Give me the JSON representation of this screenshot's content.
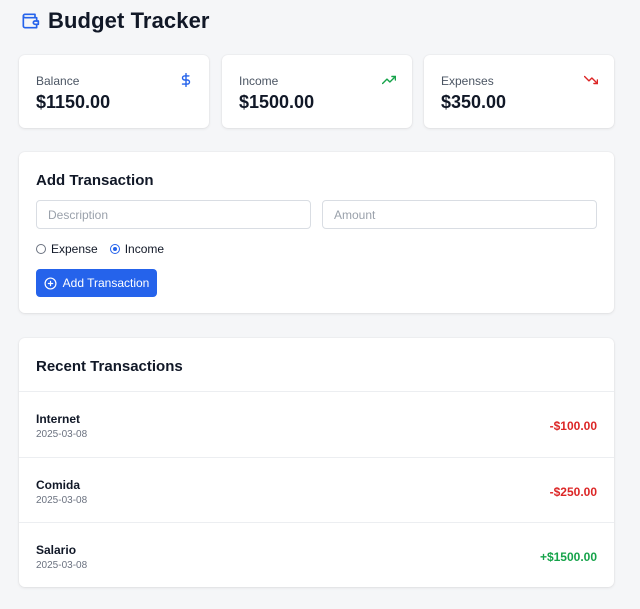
{
  "header": {
    "title": "Budget Tracker",
    "icon": "wallet-icon"
  },
  "colors": {
    "accent": "#2563eb",
    "income": "#16a34a",
    "expense": "#dc2626"
  },
  "stats": {
    "balance": {
      "label": "Balance",
      "value": "$1150.00",
      "icon": "dollar-icon"
    },
    "income": {
      "label": "Income",
      "value": "$1500.00",
      "icon": "trending-up-icon"
    },
    "expenses": {
      "label": "Expenses",
      "value": "$350.00",
      "icon": "trending-down-icon"
    }
  },
  "form": {
    "title": "Add Transaction",
    "description": {
      "placeholder": "Description",
      "value": ""
    },
    "amount": {
      "placeholder": "Amount",
      "value": ""
    },
    "types": [
      {
        "label": "Expense",
        "checked": false
      },
      {
        "label": "Income",
        "checked": true
      }
    ],
    "submit_label": "Add Transaction"
  },
  "transactions": {
    "title": "Recent Transactions",
    "items": [
      {
        "name": "Internet",
        "date": "2025-03-08",
        "amount": "-$100.00",
        "kind": "expense"
      },
      {
        "name": "Comida",
        "date": "2025-03-08",
        "amount": "-$250.00",
        "kind": "expense"
      },
      {
        "name": "Salario",
        "date": "2025-03-08",
        "amount": "+$1500.00",
        "kind": "income"
      }
    ]
  }
}
